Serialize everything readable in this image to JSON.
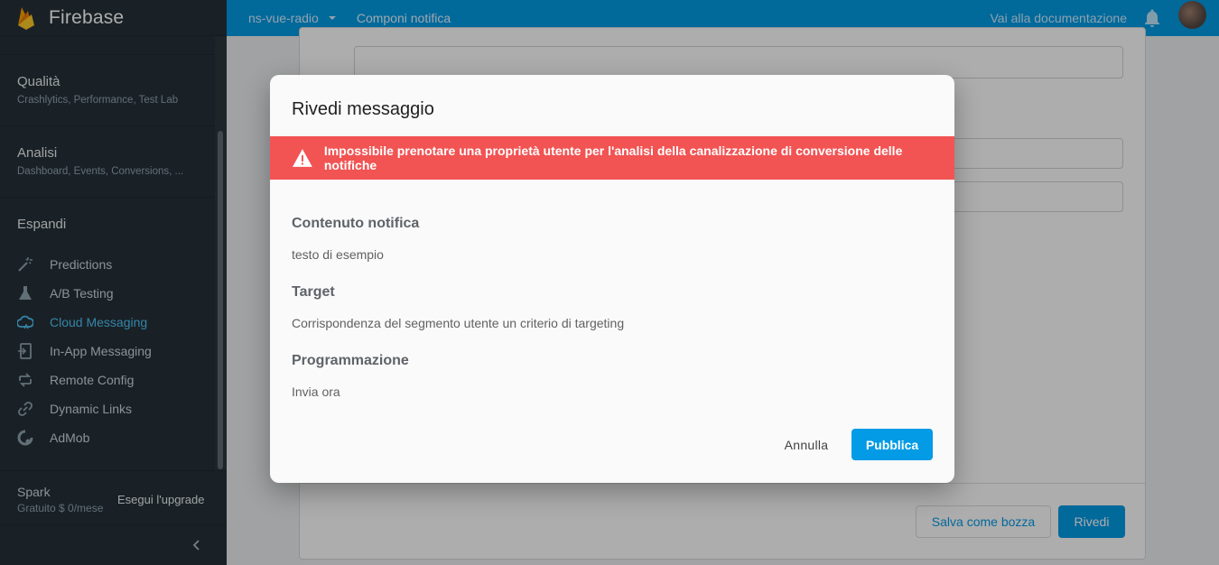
{
  "brand": {
    "name": "Firebase"
  },
  "topbar": {
    "project": "ns-vue-radio",
    "breadcrumb": "Componi notifica",
    "docs_link": "Vai alla documentazione"
  },
  "sidebar": {
    "sections": [
      {
        "title": "Qualità",
        "subtitle": "Crashlytics, Performance, Test Lab"
      },
      {
        "title": "Analisi",
        "subtitle": "Dashboard, Events, Conversions, ..."
      }
    ],
    "expand_title": "Espandi",
    "items": [
      {
        "label": "Predictions",
        "icon": "wand-icon",
        "active": false
      },
      {
        "label": "A/B Testing",
        "icon": "flask-icon",
        "active": false
      },
      {
        "label": "Cloud Messaging",
        "icon": "cloud-messaging-icon",
        "active": true
      },
      {
        "label": "In-App Messaging",
        "icon": "in-app-messaging-icon",
        "active": false
      },
      {
        "label": "Remote Config",
        "icon": "remote-config-icon",
        "active": false
      },
      {
        "label": "Dynamic Links",
        "icon": "link-icon",
        "active": false
      },
      {
        "label": "AdMob",
        "icon": "admob-icon",
        "active": false
      }
    ],
    "plan": {
      "name": "Spark",
      "price": "Gratuito $ 0/mese",
      "upgrade": "Esegui l'upgrade"
    }
  },
  "background_form": {
    "save_draft": "Salva come bozza",
    "review": "Rivedi"
  },
  "dialog": {
    "title": "Rivedi messaggio",
    "alert": "Impossibile prenotare una proprietà utente per l'analisi della canalizzazione di conversione delle notifiche",
    "sections": [
      {
        "title": "Contenuto notifica",
        "value": "testo di esempio"
      },
      {
        "title": "Target",
        "value": "Corrispondenza del segmento utente un criterio di targeting"
      },
      {
        "title": "Programmazione",
        "value": "Invia ora"
      }
    ],
    "cancel": "Annulla",
    "publish": "Pubblica"
  },
  "colors": {
    "accent": "#039be5",
    "alert": "#f25353",
    "sidebar": "#263238",
    "active_item": "#4fc3f7"
  }
}
